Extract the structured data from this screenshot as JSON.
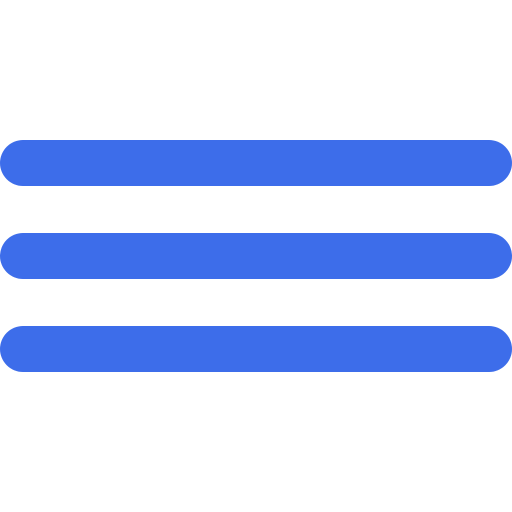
{
  "icon": {
    "name": "hamburger-menu-icon",
    "color": "#3d6dea",
    "background": "#ffffff",
    "bar_count": 3
  }
}
